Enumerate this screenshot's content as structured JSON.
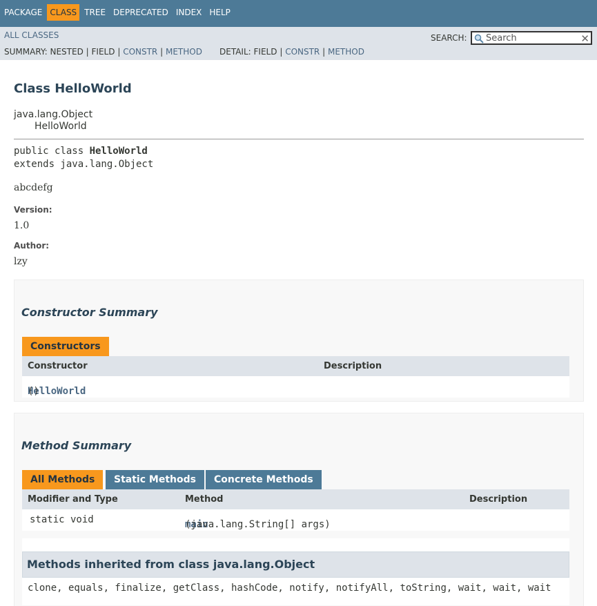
{
  "topnav": {
    "items": [
      "Package",
      "Class",
      "Tree",
      "Deprecated",
      "Index",
      "Help"
    ],
    "active": "Class"
  },
  "subnav": {
    "all_classes": "All Classes",
    "summary_label": "SUMMARY:",
    "summary_nested": "NESTED",
    "summary_field": "FIELD",
    "summary_constr": "CONSTR",
    "summary_method": "METHOD",
    "detail_label": "DETAIL:",
    "detail_field": "FIELD",
    "detail_constr": "CONSTR",
    "detail_method": "METHOD",
    "sep": "|",
    "search_label": "SEARCH:",
    "search_placeholder": "Search"
  },
  "header": {
    "title": "Class HelloWorld",
    "inherit_parent": "java.lang.Object",
    "inherit_child": "HelloWorld"
  },
  "signature": {
    "prefix": "public class ",
    "name": "HelloWorld",
    "extends": "extends java.lang.Object"
  },
  "description": "abcdefg",
  "tags": {
    "version_label": "Version:",
    "version_value": "1.0",
    "author_label": "Author:",
    "author_value": "lzy"
  },
  "constructor_summary": {
    "title": "Constructor Summary",
    "tab": "Constructors",
    "col_constructor": "Constructor",
    "col_description": "Description",
    "rows": [
      {
        "name": "HelloWorld",
        "params": "()"
      }
    ]
  },
  "method_summary": {
    "title": "Method Summary",
    "tabs": [
      "All Methods",
      "Static Methods",
      "Concrete Methods"
    ],
    "col_modifier": "Modifier and Type",
    "col_method": "Method",
    "col_description": "Description",
    "rows": [
      {
        "modifier": "static void",
        "name": "main",
        "params": "(java.lang.String[] args)"
      }
    ],
    "inherited_title": "Methods inherited from class java.lang.Object",
    "inherited_list": "clone, equals, finalize, getClass, hashCode, notify, notifyAll, toString, wait, wait, wait"
  },
  "colors": {
    "nav_bg": "#4d7a97",
    "subnav_bg": "#dee3e9",
    "accent": "#f8981d",
    "link": "#4a6782"
  }
}
